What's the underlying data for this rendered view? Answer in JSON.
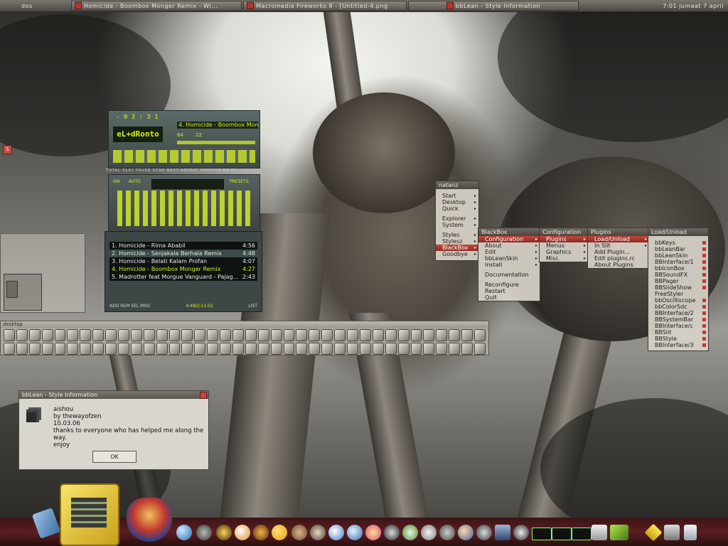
{
  "taskbar": {
    "workspace": "dos",
    "tasks": [
      "Homicide - Boombox Monger Remix - Wi...",
      "Macromedia Fireworks 8 - [Untitled-4.png",
      "bbLean - Style Information"
    ],
    "clock": "7:01 jumaat 7 april"
  },
  "corner_button": "S",
  "media_player": {
    "time_display": "- 0 3 : 3 1",
    "logo": "eL+dRonto",
    "now_playing": "4. Homicide - Boombox Monger Remix",
    "kbps": "64",
    "khz": "22",
    "controls_caption": "TOTAL PLAY PAUSE STOP NEXT REPEAT SHUFFLE EQ PL",
    "eq_labels": [
      "ON",
      "AUTO",
      "PRESETS"
    ],
    "playlist": [
      {
        "title": "1. Homicide - Rima Ababil",
        "duration": "4:56"
      },
      {
        "title": "2. Homicide - Senjakala Berhala Remix",
        "duration": "4:48"
      },
      {
        "title": "3. Homicide - Belati Kalam Profan",
        "duration": "4:07"
      },
      {
        "title": "4. Homicide - Boombox Monger Remix",
        "duration": "4:27"
      },
      {
        "title": "5. Madrotter feat Morgue Vanguard - Pajag...",
        "duration": "2:43"
      }
    ],
    "playlist_footer_left": "ADD REM SEL MISC",
    "playlist_footer_time": "4:48/2:11:01",
    "playlist_footer_right": "LIST"
  },
  "iconbar": {
    "title": "desktop"
  },
  "dialog": {
    "title": "bbLean - Style Information",
    "lines": [
      "aishou",
      "by thewayofzen",
      "10.03.06",
      "thanks to everyone who has helped me along the way.",
      "enjoy"
    ],
    "ok_label": "OK"
  },
  "menus": {
    "root": {
      "title": "natanz",
      "items": [
        "Start",
        "Desktop",
        "Quick",
        "Explorer",
        "System",
        "Styles",
        "Stylesz",
        "BlackBox",
        "Goodbye"
      ]
    },
    "blackbox": {
      "title": "BlackBox",
      "items": [
        "Configuration",
        "About",
        "Edit",
        "bbLeanSkin",
        "Install",
        "Documentation",
        "Reconfigure",
        "Restart",
        "Quit"
      ]
    },
    "configuration": {
      "title": "Configuration",
      "items": [
        "Plugins",
        "Menus",
        "Graphics",
        "Misc."
      ]
    },
    "plugins": {
      "title": "Plugins",
      "items": [
        "Load/Unload",
        "In Slit",
        "Add Plugin...",
        "Edit plugins.rc",
        "About Plugins"
      ]
    },
    "load_unload": {
      "title": "Load/Unload",
      "items": [
        "bbKeys",
        "bbLeanBar",
        "bbLeanSkin",
        "BBInterface/1",
        "bbIconBox",
        "BBSoundFX",
        "BBPager",
        "BBSlideShow",
        "FreeStyler",
        "bbOscilliscope",
        "bbColorSdc",
        "BBInterface/2",
        "BBSystemBar",
        "BBInterface/c",
        "BBSlit",
        "BBStyle",
        "BBInterface/3"
      ]
    }
  },
  "colors": {
    "accent_red": "#c23a2f",
    "lcd_green": "#d6f020",
    "dock_red": "#5a1e20"
  }
}
